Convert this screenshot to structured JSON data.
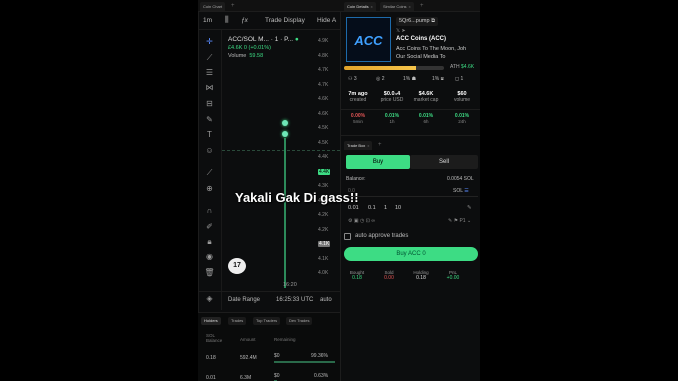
{
  "tabs_left": {
    "chart_tab": "Coin Chart",
    "add": "+"
  },
  "tabs_right": {
    "details_tab": "Coin Details",
    "similar_tab": "Similar Coins",
    "add": "+"
  },
  "toolbar": {
    "interval": "1m",
    "indicators_icon": "candles-icon",
    "fx": "ƒx",
    "trade_display": "Trade Display",
    "hide": "Hide A"
  },
  "chart": {
    "symbol": "ACC/SOL M... · 1 · P...",
    "change": "£4.6K 0 (+0.01%)",
    "volume_label": "Volume",
    "volume_value": "59.58",
    "price_ticks": [
      "4.9K",
      "4.8K",
      "4.7K",
      "4.7K",
      "4.6K",
      "4.6K",
      "4.5K",
      "4.5K",
      "4.4K",
      "4.4K",
      "4.3K",
      "4.3K",
      "4.2K",
      "4.2K",
      "4.1K",
      "4.1K",
      "4.0K"
    ],
    "highlight_tick": "4.6K",
    "current_tick": "4.3K",
    "time_label": "16:20",
    "date_range": "Date Range",
    "clock": "16:25:33 UTC",
    "scale": "auto",
    "logo": "17"
  },
  "overlay_text": "Yakali Gak Di gass!!",
  "holders": {
    "tabs": [
      "Holders",
      "Trades",
      "Top Traders",
      "Dev Trades"
    ],
    "headers": [
      "SOL Balance",
      "Amount",
      "Remaining"
    ],
    "rows": [
      {
        "sol": "0.18",
        "amount": "592.4M",
        "remaining_label": "$0",
        "pct": "99.36%",
        "fill": 0.99
      },
      {
        "sol": "0.01",
        "amount": "6.3M",
        "remaining_label": "$0",
        "pct": "0.63%",
        "fill": 0.05
      }
    ]
  },
  "token": {
    "logo_text": "ACC",
    "address": "5Qr6...pump",
    "name": "ACC Coins (ACC)",
    "desc_line1": "Acc Coins To The Moon, Joh",
    "desc_line2": "Our Social Media To",
    "curve_progress": 0.72,
    "ath_label": "ATH",
    "ath_value": "$4.6K",
    "counts": [
      "3",
      "2",
      "1%",
      "1%",
      "1"
    ],
    "metrics": [
      {
        "value": "7m ago",
        "label": "created"
      },
      {
        "value": "$0.0₄4",
        "label": "price USD"
      },
      {
        "value": "$4.6K",
        "label": "market cap"
      },
      {
        "value": "$60",
        "label": "volume"
      }
    ],
    "changes": [
      {
        "value": "0.00%",
        "label": "5min",
        "color": "#e05555"
      },
      {
        "value": "0.01%",
        "label": "1h",
        "color": "#3ddc84"
      },
      {
        "value": "0.01%",
        "label": "6h",
        "color": "#3ddc84"
      },
      {
        "value": "0.01%",
        "label": "24h",
        "color": "#3ddc84"
      }
    ]
  },
  "trade": {
    "tab": "Trade Box",
    "buy": "Buy",
    "sell": "Sell",
    "balance_label": "Balance:",
    "balance_value": "0.0054 SOL",
    "amount_placeholder": "0.0",
    "currency": "SOL",
    "quick": [
      "0.01",
      "0.1",
      "1",
      "10"
    ],
    "auto_approve": "auto approve trades",
    "buy_button": "Buy ACC 0",
    "positions": [
      {
        "label": "Bought",
        "value": "0.18",
        "color": "#3ddc84"
      },
      {
        "label": "Sold",
        "value": "0.00",
        "color": "#e05555"
      },
      {
        "label": "Holding",
        "value": "0.18",
        "color": "#ddd"
      },
      {
        "label": "PnL",
        "value": "+0.00",
        "color": "#3ddc84"
      }
    ]
  },
  "colors": {
    "accent": "#3ddc84",
    "bg": "#0c0d0e",
    "loss": "#e05555"
  }
}
